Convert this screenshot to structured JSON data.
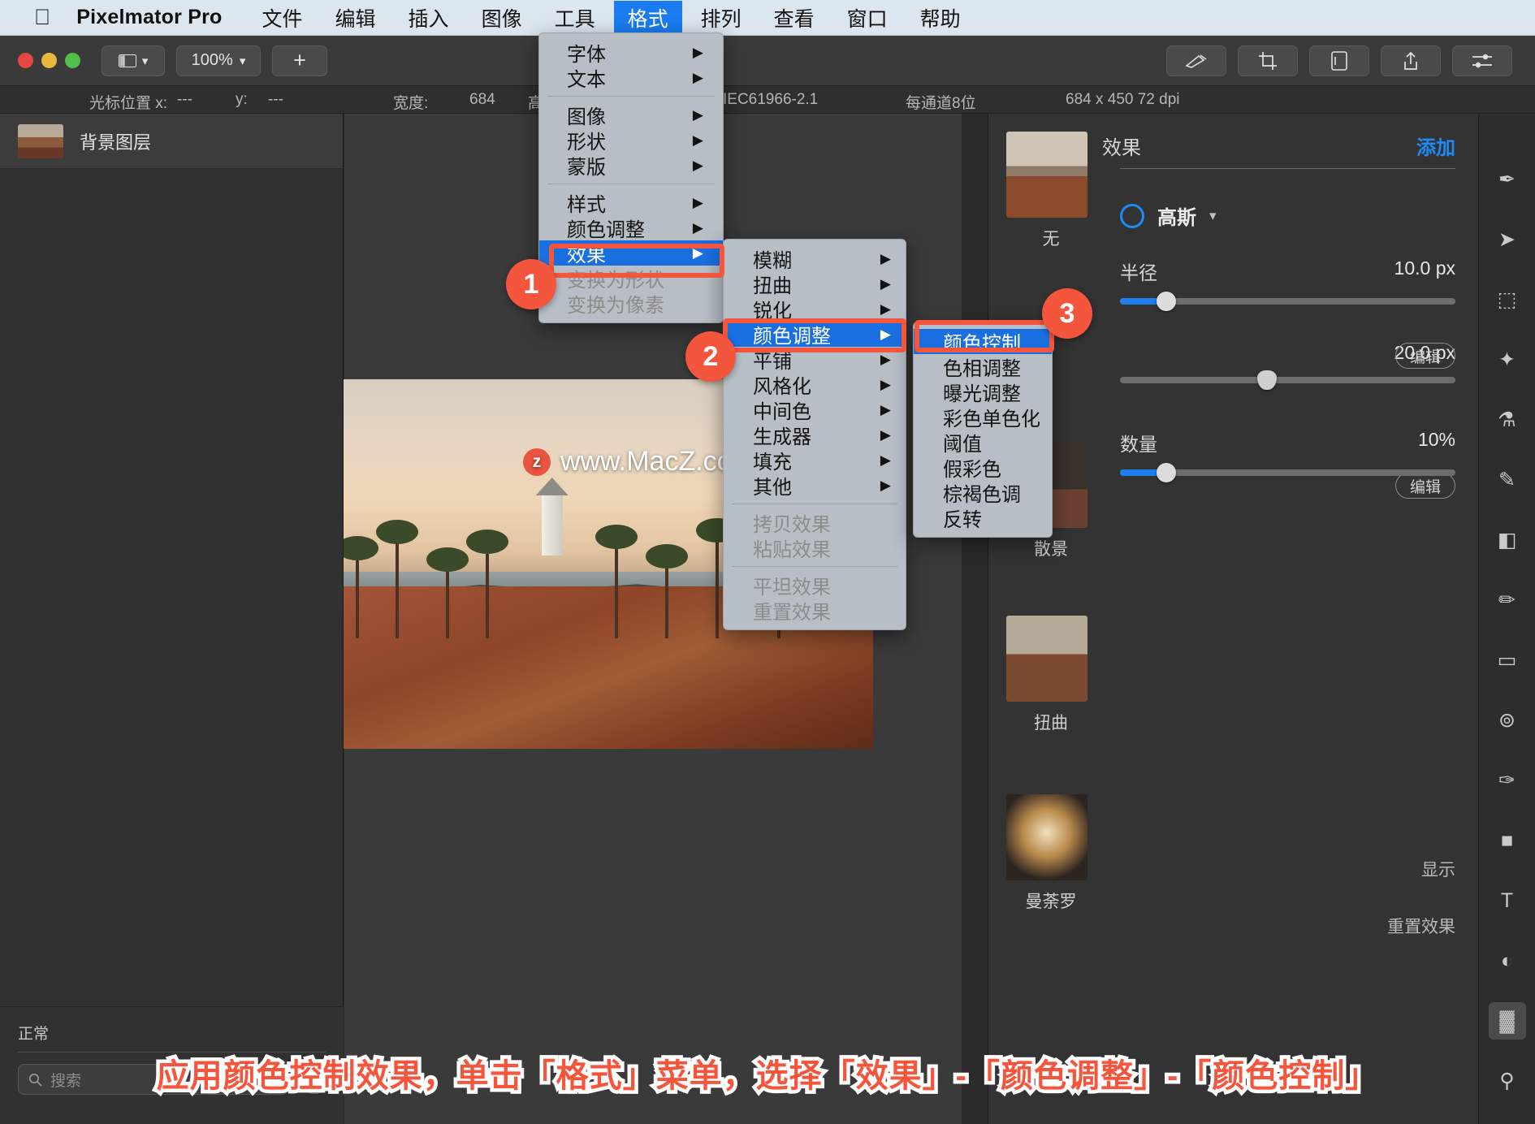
{
  "menubar": {
    "apple_icon": "apple-icon",
    "app_name": "Pixelmator Pro",
    "items": [
      {
        "label": "文件",
        "active": false
      },
      {
        "label": "编辑",
        "active": false
      },
      {
        "label": "插入",
        "active": false
      },
      {
        "label": "图像",
        "active": false
      },
      {
        "label": "工具",
        "active": false
      },
      {
        "label": "格式",
        "active": true
      },
      {
        "label": "排列",
        "active": false
      },
      {
        "label": "查看",
        "active": false
      },
      {
        "label": "窗口",
        "active": false
      },
      {
        "label": "帮助",
        "active": false
      }
    ]
  },
  "toolbar": {
    "view_label": "▥",
    "zoom_label": "100%",
    "add_label": "+",
    "icons": [
      "retouch-icon",
      "crop-icon",
      "export-icon",
      "share-icon",
      "sliders-icon"
    ]
  },
  "infobar": {
    "cursor_label": "光标位置 x:",
    "cursor_x": "---",
    "cursor_y_label": "y:",
    "cursor_y": "---",
    "width_label": "宽度:",
    "width_value": "684",
    "height_label": "高度:",
    "color_profile": "IEC61966-2.1",
    "bit_depth": "每通道8位",
    "dimensions": "684 x 450 72 dpi"
  },
  "layers": {
    "items": [
      {
        "name": "背景图层"
      }
    ],
    "blend_mode": "正常",
    "search_placeholder": "搜索",
    "search_icon": "search-icon",
    "filter_icon": "filter-icon"
  },
  "canvas": {
    "watermark": "www.MacZ.com",
    "watermark_badge": "z"
  },
  "effects_panel": {
    "title": "效果",
    "add_label": "添加",
    "none_label": "无",
    "kind_label": "高斯",
    "presets": [
      {
        "label": "散景"
      },
      {
        "label": "扭曲"
      },
      {
        "label": "曼荼罗"
      }
    ],
    "sliders": [
      {
        "label": "半径",
        "value": "10.0 px",
        "fill_pct": 14,
        "style": "round",
        "edit": null
      },
      {
        "label": "",
        "value": "20.0 px",
        "fill_pct": 0,
        "style": "pin",
        "edit": "编辑"
      },
      {
        "label": "数量",
        "value": "10%",
        "fill_pct": 14,
        "style": "round",
        "edit": "编辑"
      }
    ],
    "footer": {
      "show_label": "显示",
      "reset_label": "重置效果"
    }
  },
  "tools_rail": [
    {
      "icon": "heal-icon",
      "selected": false
    },
    {
      "icon": "arrow-icon",
      "selected": false
    },
    {
      "icon": "marquee-icon",
      "selected": false
    },
    {
      "icon": "magic-wand-icon",
      "selected": false
    },
    {
      "icon": "eyedropper-icon",
      "selected": false
    },
    {
      "icon": "paint-brush-icon",
      "selected": false
    },
    {
      "icon": "gradient-icon",
      "selected": false
    },
    {
      "icon": "pencil-icon",
      "selected": false
    },
    {
      "icon": "eraser-icon",
      "selected": false
    },
    {
      "icon": "clone-icon",
      "selected": false
    },
    {
      "icon": "pen-icon",
      "selected": false
    },
    {
      "icon": "shape-icon",
      "selected": false
    },
    {
      "icon": "text-icon",
      "selected": false
    },
    {
      "icon": "color-adjust-icon",
      "selected": false
    },
    {
      "icon": "effects-icon",
      "selected": true
    },
    {
      "icon": "zoom-icon",
      "selected": false
    }
  ],
  "menu_format": {
    "title": "格式",
    "groups": [
      [
        {
          "label": "字体",
          "submenu": true,
          "disabled": false
        },
        {
          "label": "文本",
          "submenu": true,
          "disabled": false
        }
      ],
      [
        {
          "label": "图像",
          "submenu": true,
          "disabled": false
        },
        {
          "label": "形状",
          "submenu": true,
          "disabled": false
        },
        {
          "label": "蒙版",
          "submenu": true,
          "disabled": false
        }
      ],
      [
        {
          "label": "样式",
          "submenu": true,
          "disabled": false
        },
        {
          "label": "颜色调整",
          "submenu": true,
          "disabled": false
        },
        {
          "label": "效果",
          "submenu": true,
          "disabled": false,
          "highlighted": true
        },
        {
          "label": "变换为形状",
          "submenu": false,
          "disabled": true
        },
        {
          "label": "变换为像素",
          "submenu": false,
          "disabled": true
        }
      ]
    ]
  },
  "menu_effects": {
    "groups": [
      [
        {
          "label": "模糊",
          "submenu": true
        },
        {
          "label": "扭曲",
          "submenu": true
        },
        {
          "label": "锐化",
          "submenu": true
        },
        {
          "label": "颜色调整",
          "submenu": true,
          "highlighted": true
        },
        {
          "label": "平铺",
          "submenu": true
        },
        {
          "label": "风格化",
          "submenu": true
        },
        {
          "label": "中间色",
          "submenu": true
        },
        {
          "label": "生成器",
          "submenu": true
        },
        {
          "label": "填充",
          "submenu": true
        },
        {
          "label": "其他",
          "submenu": true
        }
      ],
      [
        {
          "label": "拷贝效果",
          "submenu": false,
          "disabled": true
        },
        {
          "label": "粘贴效果",
          "submenu": false,
          "disabled": true
        }
      ],
      [
        {
          "label": "平坦效果",
          "submenu": false,
          "disabled": true
        },
        {
          "label": "重置效果",
          "submenu": false,
          "disabled": true
        }
      ]
    ]
  },
  "menu_coloradj": {
    "items": [
      {
        "label": "颜色控制",
        "highlighted": true
      },
      {
        "label": "色相调整"
      },
      {
        "label": "曝光调整"
      },
      {
        "label": "彩色单色化"
      },
      {
        "label": "阈值"
      },
      {
        "label": "假彩色"
      },
      {
        "label": "棕褐色调"
      },
      {
        "label": "反转"
      }
    ]
  },
  "steps": [
    {
      "number": "1"
    },
    {
      "number": "2"
    },
    {
      "number": "3"
    }
  ],
  "caption": {
    "text": "应用颜色控制效果，单击「格式」菜单，选择「效果」-「颜色调整」-「颜色控制」",
    "color": "#f4553d"
  }
}
